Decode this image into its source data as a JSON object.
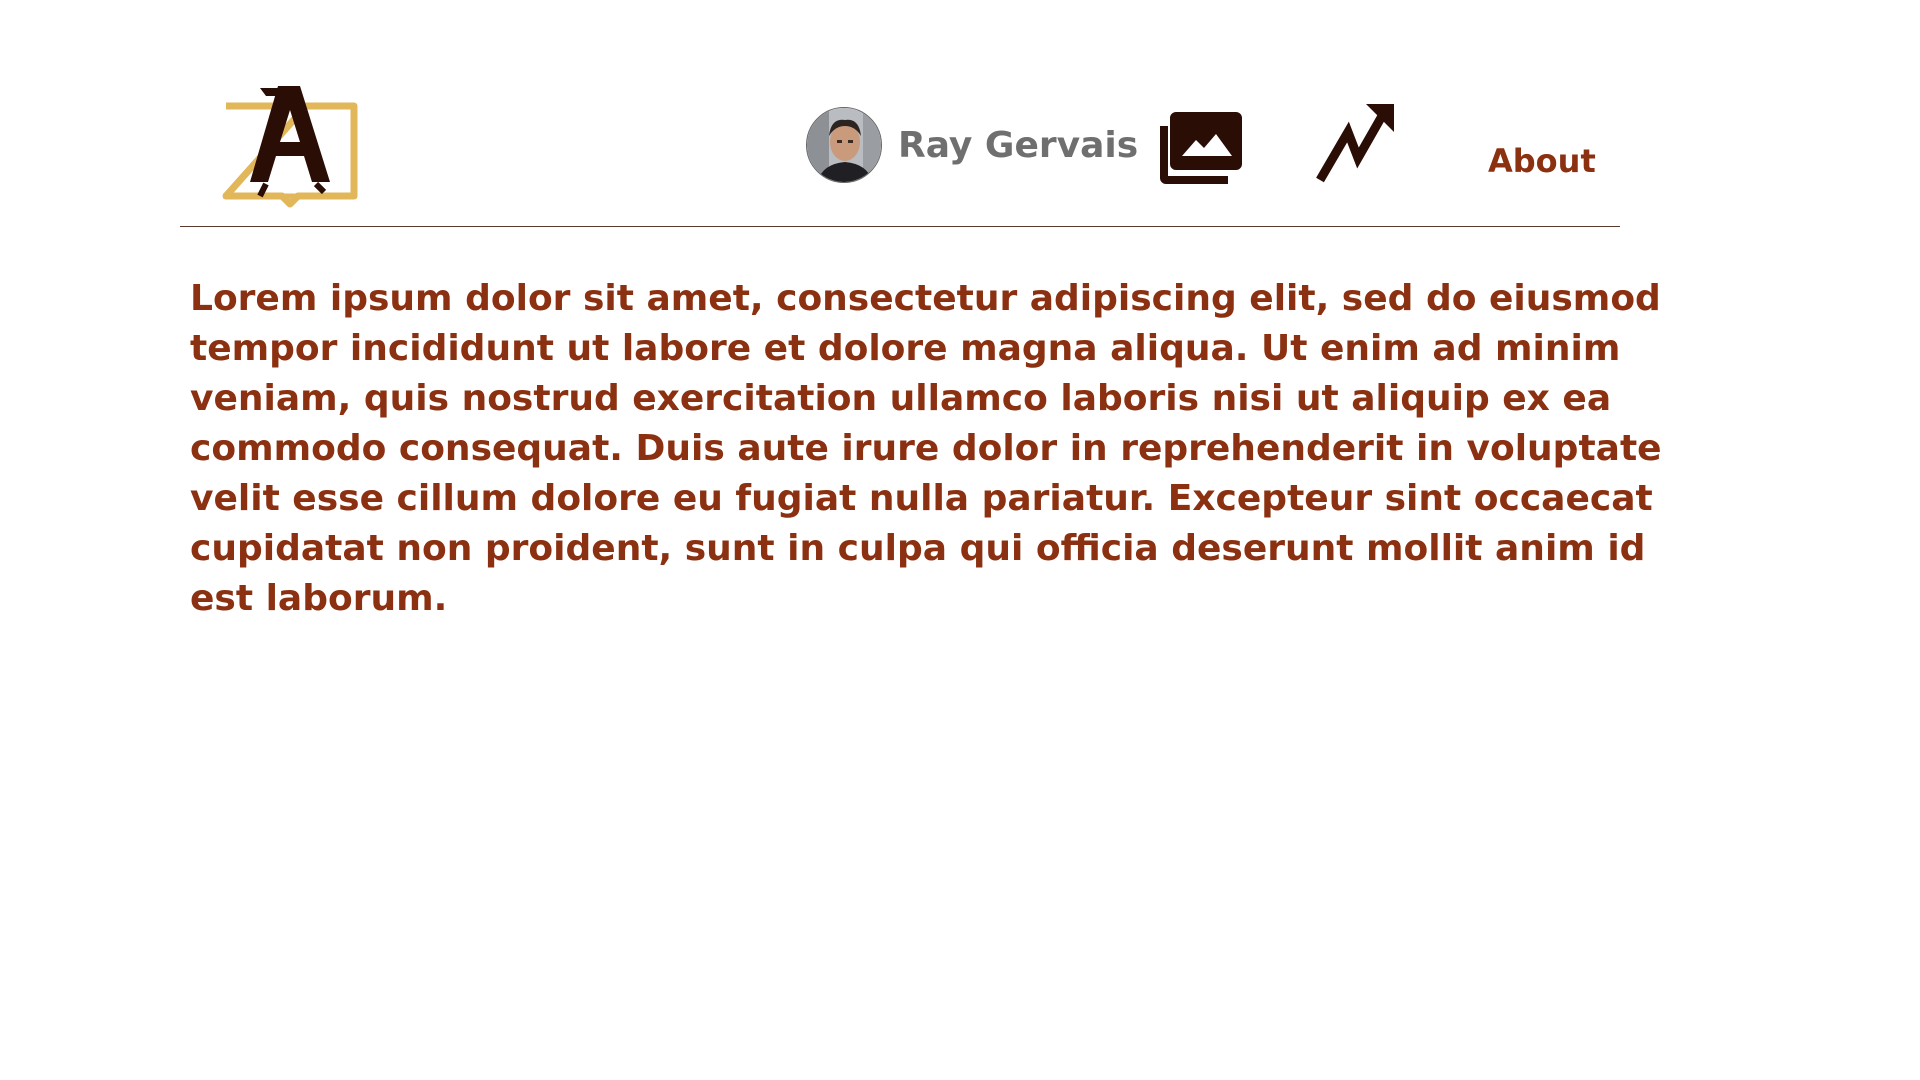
{
  "header": {
    "logo_icon": "book-letter-a-logo-icon",
    "nav": {
      "profile_name": "Ray Gervais",
      "avatar_icon": "user-avatar-photo",
      "gallery_icon": "photo-library-icon",
      "stats_icon": "trending-up-icon",
      "about_label": "About"
    }
  },
  "main": {
    "paragraph": "Lorem ipsum dolor sit amet, consectetur adipiscing elit, sed do eiusmod tempor incididunt ut labore et dolore magna aliqua. Ut enim ad minim veniam, quis nostrud exercitation ullamco laboris nisi ut aliquip ex ea commodo consequat. Duis aute irure dolor in reprehenderit in voluptate velit esse cillum dolore eu fugiat nulla pariatur. Excepteur sint occaecat cupidatat non proident, sunt in culpa qui officia deserunt mollit anim id est laborum."
  },
  "colors": {
    "accent_text": "#8b3010",
    "logo_gold": "#e2b75a",
    "icon_dark": "#2a0d05",
    "muted_text": "#6f6f6f",
    "divider": "#5a3a2e"
  }
}
